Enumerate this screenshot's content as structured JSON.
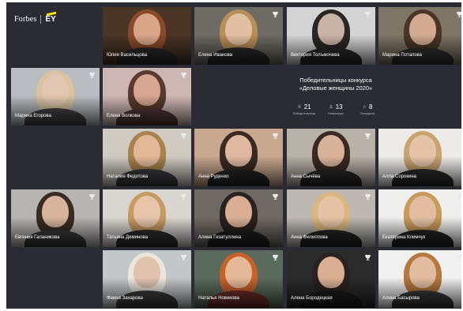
{
  "logo": {
    "brand": "Forbes",
    "partner": "EY"
  },
  "info": {
    "title_line1": "Победительницы конкурса",
    "title_line2": "«Деловые женщины 2020»",
    "stats": [
      {
        "icon": "trophy-icon",
        "value": "21",
        "label": "Победительницы"
      },
      {
        "icon": "person-icon",
        "value": "13",
        "label": "Номинации"
      },
      {
        "icon": "star-icon",
        "value": "8",
        "label": "Спецпризы"
      }
    ]
  },
  "cards": [
    {
      "category": "",
      "name": "Юлия Васильцова",
      "company": "",
      "trophy": false,
      "colors": {
        "bg": "#4a3426",
        "hair": "#8a4a2a",
        "skin": "#d8a687",
        "body": "#2a2a2a"
      }
    },
    {
      "category": "",
      "name": "Елена Иванова",
      "company": "",
      "trophy": true,
      "colors": {
        "bg": "#6e6a64",
        "hair": "#b88f58",
        "skin": "#e1bfa2",
        "body": "#2a2a2a"
      }
    },
    {
      "category": "",
      "name": "Виктория Толъмочева",
      "company": "",
      "trophy": true,
      "colors": {
        "bg": "#d4d4d4",
        "hair": "#2a2624",
        "skin": "#c9b3a6",
        "body": "#2a2a2a"
      }
    },
    {
      "category": "",
      "name": "Марина Потапова",
      "company": "",
      "trophy": true,
      "colors": {
        "bg": "#7d7566",
        "hair": "#4a3628",
        "skin": "#d3aa90",
        "body": "#303030"
      }
    },
    {
      "category": "",
      "name": "Марина Егорова",
      "company": "",
      "trophy": true,
      "colors": {
        "bg": "#b9bcc0",
        "hair": "#d9c3a0",
        "skin": "#e3c6b1",
        "body": "#444444"
      }
    },
    {
      "category": "",
      "name": "Елена Волкова",
      "company": "",
      "trophy": true,
      "colors": {
        "bg": "#cdb7b4",
        "hair": "#5a3a2e",
        "skin": "#d6a690",
        "body": "#553838"
      }
    },
    {
      "category": "",
      "name": "Наталия Федотова",
      "company": "",
      "trophy": true,
      "colors": {
        "bg": "#cfcac2",
        "hair": "#a9824e",
        "skin": "#e1b999",
        "body": "#3d3d40"
      }
    },
    {
      "category": "",
      "name": "Анна Руденко",
      "company": "",
      "trophy": true,
      "colors": {
        "bg": "#c8a88f",
        "hair": "#3a2a22",
        "skin": "#e0b8a0",
        "body": "#262626"
      }
    },
    {
      "category": "",
      "name": "Анна Сычёва",
      "company": "",
      "trophy": true,
      "colors": {
        "bg": "#b8b2a8",
        "hair": "#3a2a22",
        "skin": "#d9b29a",
        "body": "#2a2a2a"
      }
    },
    {
      "category": "",
      "name": "Алла Сорокина",
      "company": "",
      "trophy": true,
      "colors": {
        "bg": "#ecebe8",
        "hair": "#c7a46f",
        "skin": "#e5c3a8",
        "body": "#2d2d2d"
      }
    },
    {
      "category": "",
      "name": "Евгения Галаникова",
      "company": "",
      "trophy": true,
      "colors": {
        "bg": "#b7b5b2",
        "hair": "#3a2c24",
        "skin": "#d7b49b",
        "body": "#3a3a3a"
      }
    },
    {
      "category": "",
      "name": "Татьяна Деминова",
      "company": "",
      "trophy": true,
      "colors": {
        "bg": "#d9d6d1",
        "hair": "#c69b62",
        "skin": "#e6c5aa",
        "body": "#2e2e30"
      }
    },
    {
      "category": "",
      "name": "Алина Гизатуллина",
      "company": "",
      "trophy": true,
      "colors": {
        "bg": "#6f6a63",
        "hair": "#2a2220",
        "skin": "#d9ae92",
        "body": "#1f1f1f"
      }
    },
    {
      "category": "",
      "name": "Анна Филиппова",
      "company": "",
      "trophy": true,
      "colors": {
        "bg": "#bdb9b2",
        "hair": "#d9b77e",
        "skin": "#e5c3a7",
        "body": "#262628"
      }
    },
    {
      "category": "",
      "name": "Екатерина Климчук",
      "company": "",
      "trophy": true,
      "colors": {
        "bg": "#efefee",
        "hair": "#c79b5a",
        "skin": "#e2bda0",
        "body": "#262626"
      }
    },
    {
      "category": "",
      "name": "Фаина Захарова",
      "company": "",
      "trophy": true,
      "colors": {
        "bg": "#c4c7ca",
        "hair": "#ece5db",
        "skin": "#e0c2ad",
        "body": "#3c3c3c"
      }
    },
    {
      "category": "",
      "name": "Наталья Новикова",
      "company": "",
      "trophy": true,
      "colors": {
        "bg": "#5a6a5c",
        "hair": "#c7622a",
        "skin": "#e5b898",
        "body": "#6e2f2a"
      }
    },
    {
      "category": "",
      "name": "Алена Бородецкая",
      "company": "",
      "trophy": true,
      "colors": {
        "bg": "#2b2b2b",
        "hair": "#2a2220",
        "skin": "#d9ae92",
        "body": "#1b1b1b"
      }
    },
    {
      "category": "",
      "name": "Алина Басырова",
      "company": "",
      "trophy": true,
      "colors": {
        "bg": "#f0f0f0",
        "hair": "#b5783e",
        "skin": "#e2bc9e",
        "body": "#3a3a3a"
      }
    }
  ]
}
